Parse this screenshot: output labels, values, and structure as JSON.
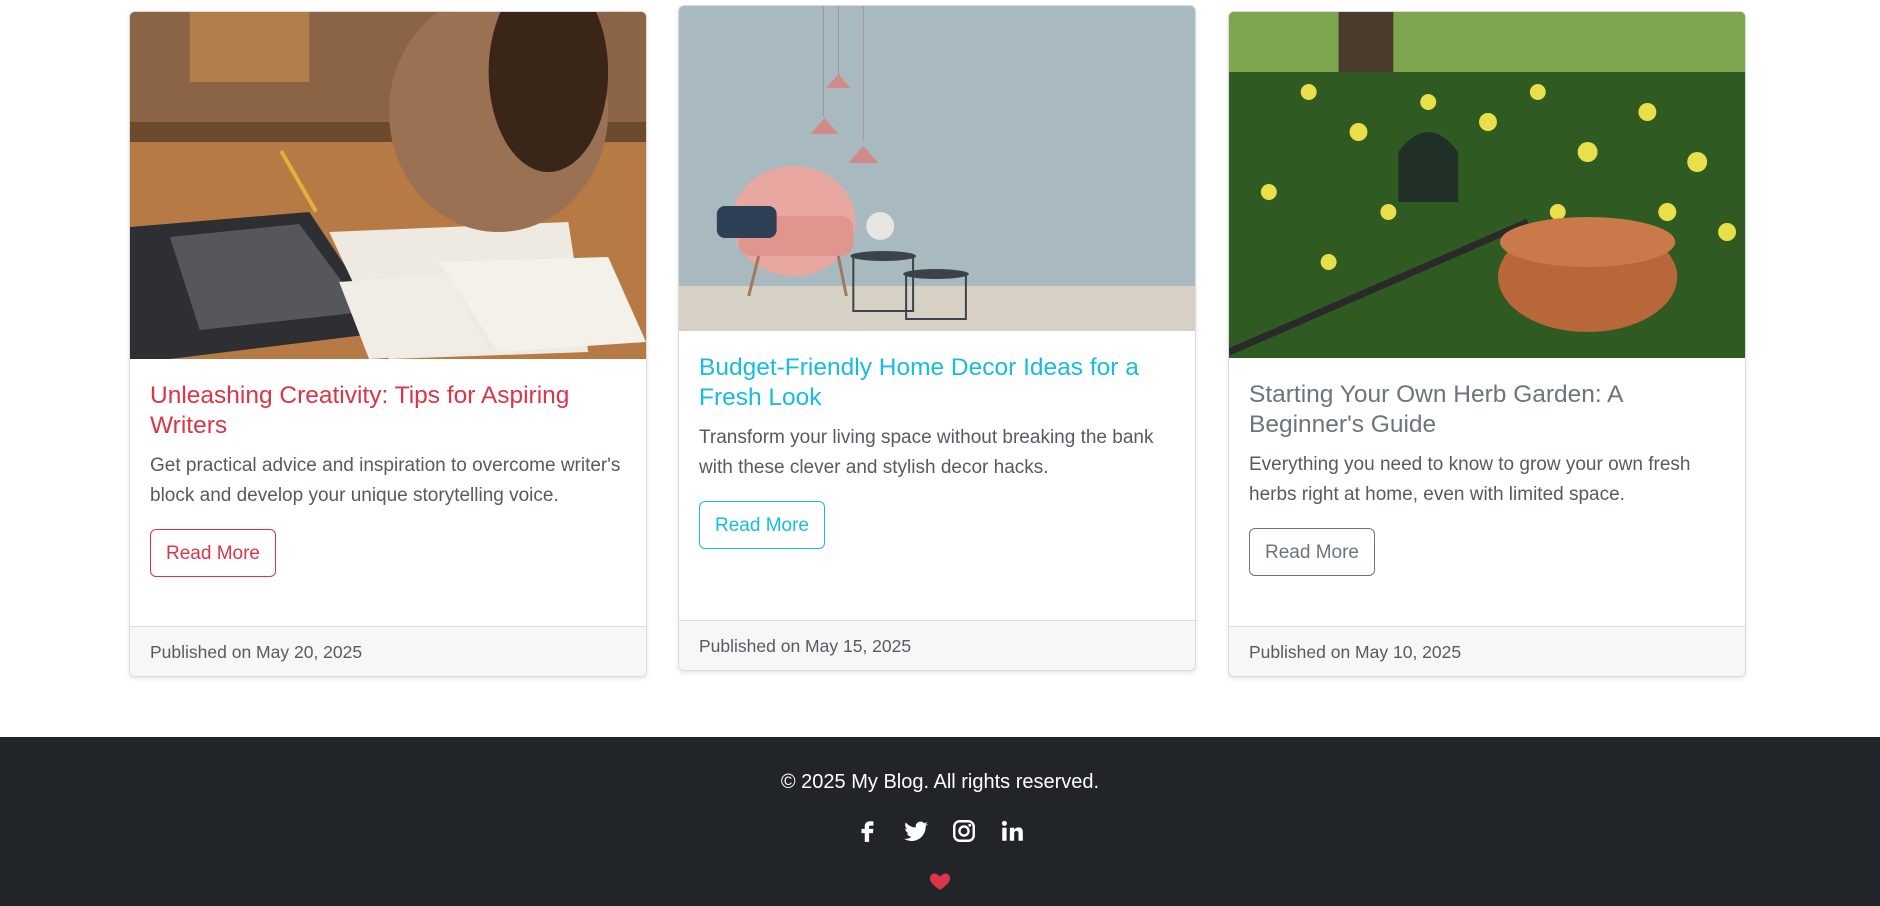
{
  "posts": [
    {
      "title": "Unleashing Creativity: Tips for Aspiring Writers",
      "excerpt": "Get practical advice and inspiration to overcome writer's block and develop your unique storytelling voice.",
      "button": "Read More",
      "published": "Published on May 20, 2025",
      "accent": "#dc3545",
      "image": "person-writing-at-desk-with-laptop"
    },
    {
      "title": "Budget-Friendly Home Decor Ideas for a Fresh Look",
      "excerpt": "Transform your living space without breaking the bank with these clever and stylish decor hacks.",
      "button": "Read More",
      "published": "Published on May 15, 2025",
      "accent": "#17bde0",
      "image": "pink-chair-with-pendant-lamps"
    },
    {
      "title": "Starting Your Own Herb Garden: A Beginner's Guide",
      "excerpt": "Everything you need to know to grow your own fresh herbs right at home, even with limited space.",
      "button": "Read More",
      "published": "Published on May 10, 2025",
      "accent": "#6c757d",
      "image": "garden-with-daffodils-watering-can-and-pot"
    }
  ],
  "footer": {
    "copyright": "© 2025 My Blog. All rights reserved.",
    "social": [
      "facebook-icon",
      "twitter-icon",
      "instagram-icon",
      "linkedin-icon"
    ],
    "heart_icon": "heart-icon",
    "heart_color": "#dc3545"
  }
}
